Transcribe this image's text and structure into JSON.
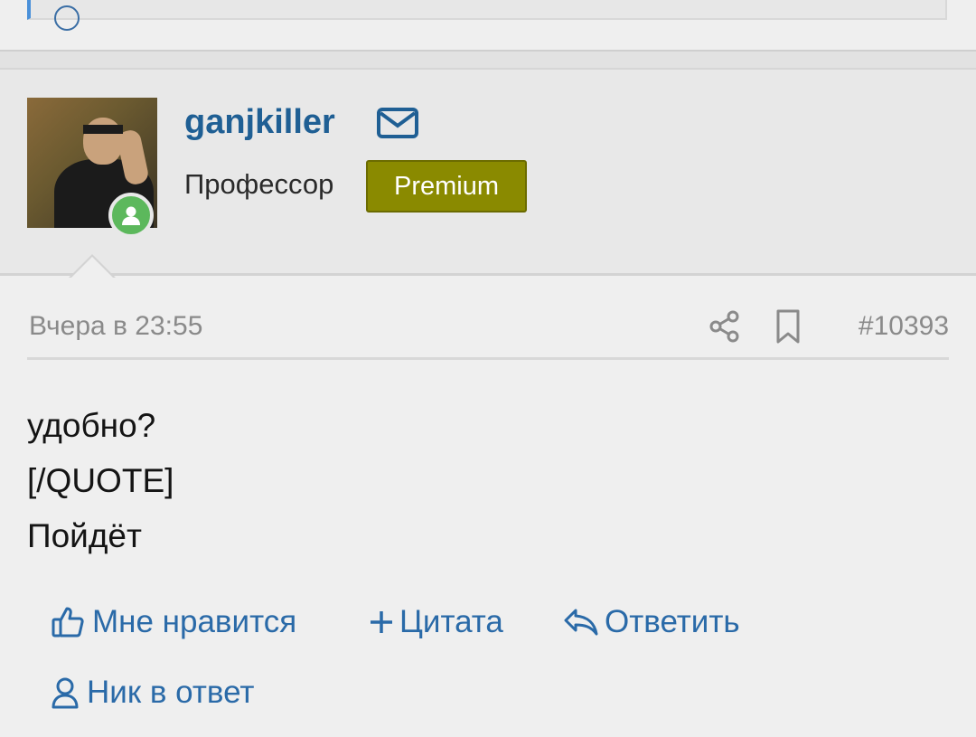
{
  "user": {
    "username": "ganjkiller",
    "title": "Профессор",
    "badge": "Premium"
  },
  "post": {
    "date": "Вчера в 23:55",
    "number": "#10393",
    "lines": [
      "удобно?",
      "[/QUOTE]",
      "Пойдёт"
    ]
  },
  "actions": {
    "like": "Мне нравится",
    "quote": "Цитата",
    "reply": "Ответить",
    "mention": "Ник в ответ"
  },
  "icons": {
    "mail": "mail-icon",
    "share": "share-icon",
    "bookmark": "bookmark-icon",
    "like": "thumbs-up-icon",
    "quote": "plus-icon",
    "reply": "reply-icon",
    "mention": "user-icon",
    "online": "online-status-icon"
  },
  "colors": {
    "link": "#2a6aa8",
    "username": "#1f5f94",
    "premium_badge": "#8a8a00",
    "online": "#5cb85c"
  }
}
